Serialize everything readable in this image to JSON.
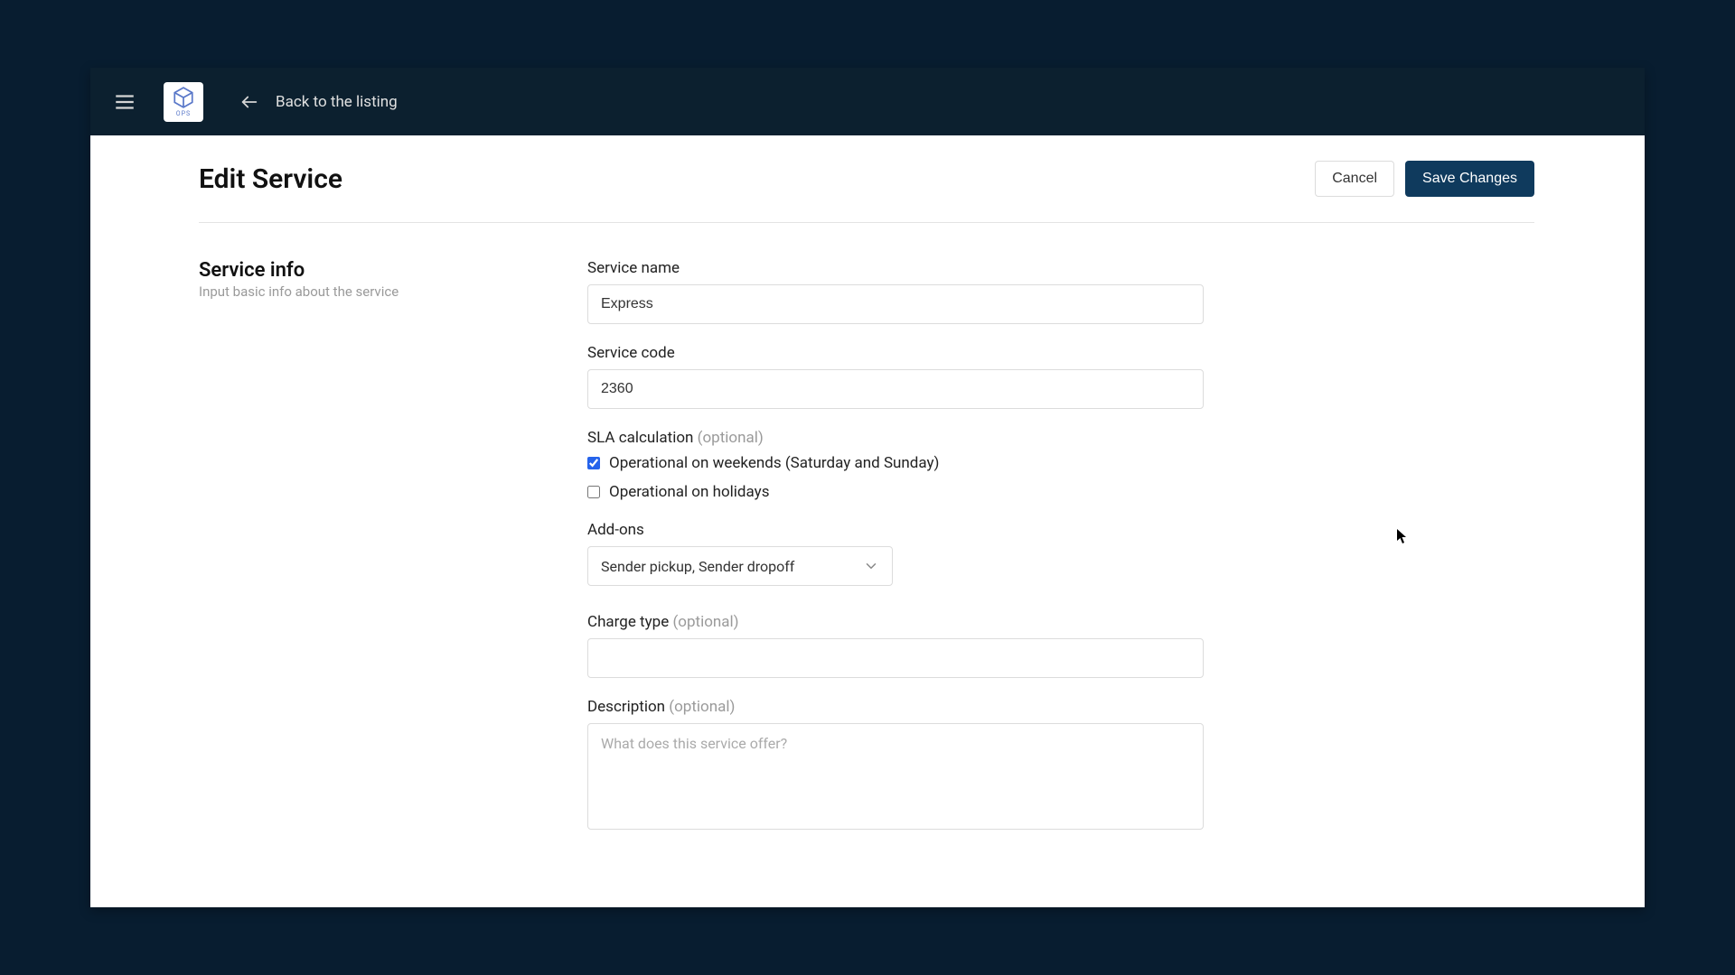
{
  "topbar": {
    "back_label": "Back to the listing"
  },
  "header": {
    "title": "Edit Service",
    "cancel_label": "Cancel",
    "save_label": "Save Changes"
  },
  "section": {
    "title": "Service info",
    "subtitle": "Input basic info about the service"
  },
  "fields": {
    "service_name": {
      "label": "Service name",
      "value": "Express"
    },
    "service_code": {
      "label": "Service code",
      "value": "2360"
    },
    "sla": {
      "label": "SLA calculation ",
      "optional": "(optional)",
      "weekends_label": "Operational on weekends (Saturday and Sunday)",
      "holidays_label": "Operational on holidays"
    },
    "addons": {
      "label": "Add-ons",
      "value": "Sender pickup, Sender dropoff"
    },
    "charge_type": {
      "label": "Charge type ",
      "optional": "(optional)",
      "value": ""
    },
    "description": {
      "label": "Description ",
      "optional": "(optional)",
      "placeholder": "What does this service offer?"
    }
  }
}
